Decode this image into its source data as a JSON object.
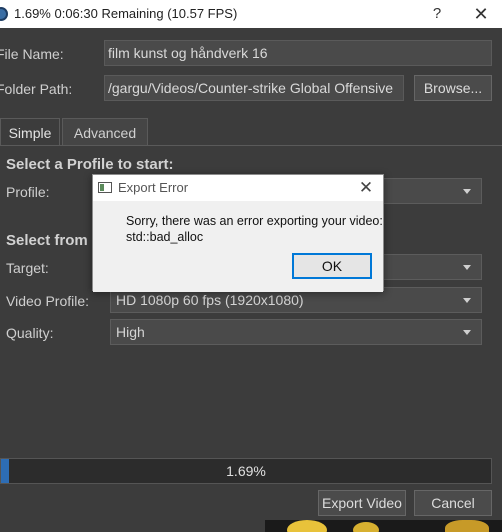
{
  "window": {
    "title": "1.69%  0:06:30 Remaining (10.57 FPS)",
    "help_label": "?",
    "close_label": "✕"
  },
  "file": {
    "name_label": "File Name:",
    "name_value": "film kunst og håndverk 16",
    "folder_label": "Folder Path:",
    "folder_value": "/gargu/Videos/Counter-strike  Global Offensive",
    "browse_label": "Browse..."
  },
  "tabs": [
    {
      "label": "Simple",
      "active": true
    },
    {
      "label": "Advanced",
      "active": false
    }
  ],
  "simple": {
    "profile_heading": "Select a Profile to start:",
    "profile_label": "Profile:",
    "profile_value": "",
    "from_heading": "Select from",
    "target_label": "Target:",
    "target_value": "",
    "video_profile_label": "Video Profile:",
    "video_profile_value": "HD 1080p 60 fps (1920x1080)",
    "quality_label": "Quality:",
    "quality_value": "High"
  },
  "progress": {
    "value": 1.69,
    "text": "1.69%"
  },
  "buttons": {
    "export_label": "Export Video",
    "cancel_label": "Cancel"
  },
  "dialog": {
    "title": "Export Error",
    "close_label": "✕",
    "message_line1": "Sorry, there was an error exporting your video:",
    "message_line2": "std::bad_alloc",
    "ok_label": "OK"
  },
  "colors": {
    "accent": "#2d6db5",
    "dialog_focus": "#0078d7",
    "background": "#3c3c3c"
  }
}
